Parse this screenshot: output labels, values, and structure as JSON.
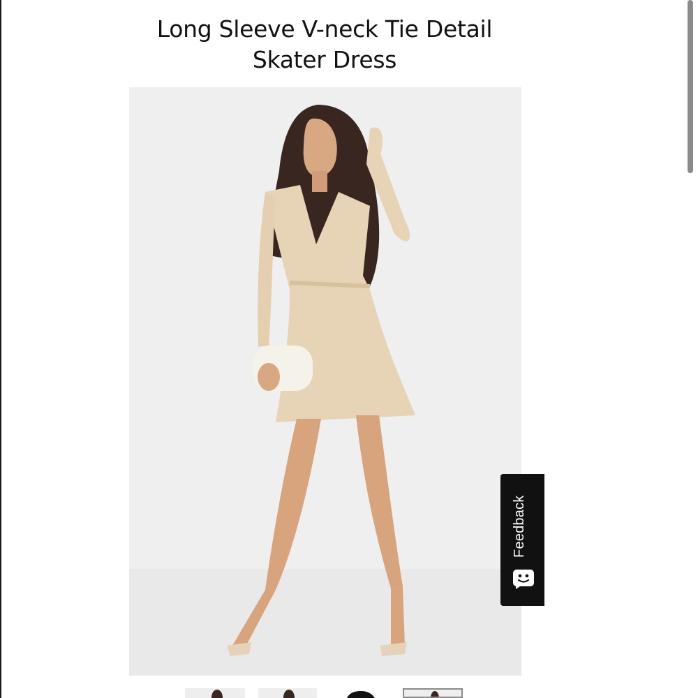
{
  "product": {
    "title_line1": "Long Sleeve V-neck Tie Detail",
    "title_line2": "Skater Dress"
  },
  "feedback": {
    "label": "Feedback",
    "icon": "chat-smile-icon"
  },
  "thumbnails": {
    "count": 4,
    "selected_index": 3
  },
  "colors": {
    "dress": "#e7d3b5",
    "background": "#eeeeee",
    "feedback_bg": "#111111"
  }
}
